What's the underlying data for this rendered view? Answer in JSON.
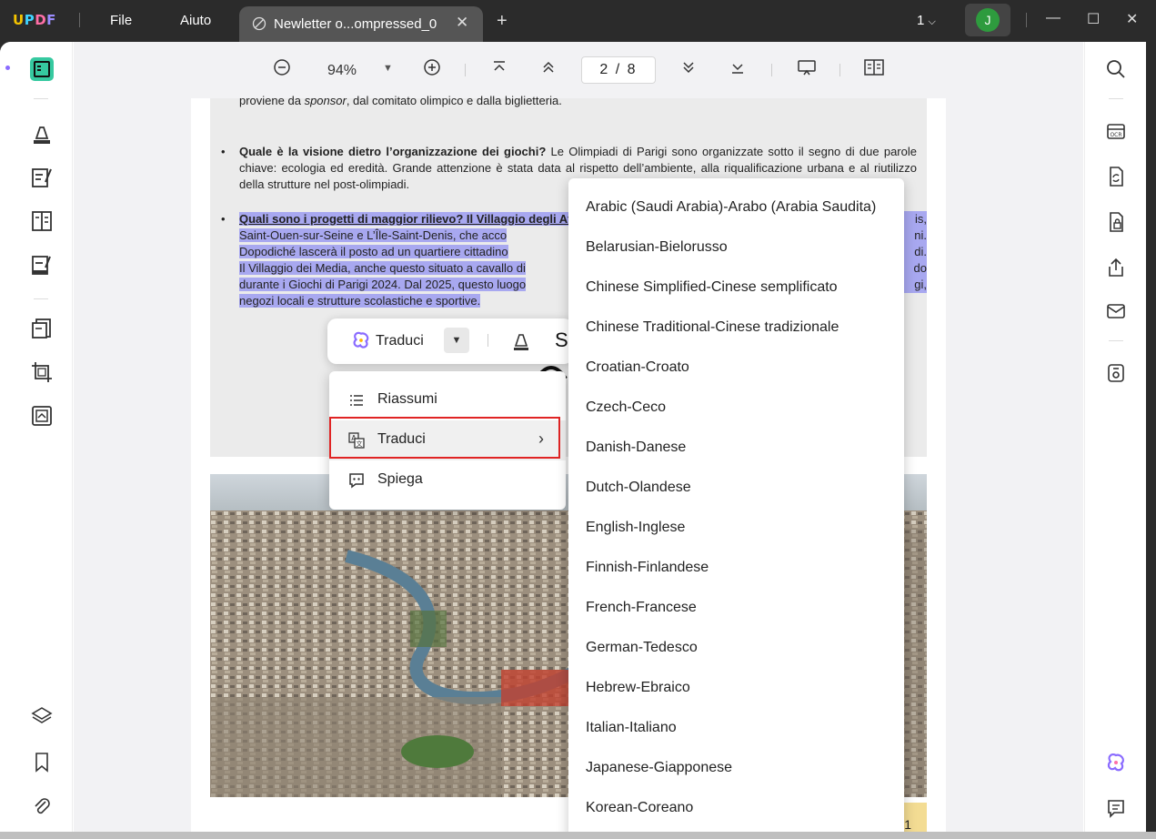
{
  "titlebar": {
    "logo": "UPDF",
    "menu": [
      "File",
      "Aiuto"
    ],
    "tab_title": "Newletter o...ompressed_0",
    "page_indicator": "1",
    "user_initial": "J"
  },
  "toolbar": {
    "zoom": "94%",
    "current_page": "2",
    "total_pages": "8",
    "page_separator": "/"
  },
  "document": {
    "line_top": {
      "prefix": "proviene da ",
      "italic": "sponsor",
      "suffix": ", dal comitato olimpico e dalla biglietteria."
    },
    "bullet2_bold": "Quale è la visione dietro l’organizzazione dei giochi?",
    "bullet2_text": " Le Olimpiadi di Parigi sono organizzate sotto il segno di due parole chiave: ecologia ed eredità. Grande attenzione è stata data al rispetto dell’ambiente, alla riqualificazione urbana e al riutilizzo della strutture nel post-olimpiadi.",
    "bullet3_lines": [
      "Quali sono i progetti di maggior rilievo? Il Villaggio degli At",
      "Saint-Ouen-sur-Seine e L’Île-Saint-Denis, che acco",
      "Dopodiché lascerà il posto ad un quartiere cittadino",
      "Il Villaggio dei Media, anche questo situato a cavallo di",
      "durante i Giochi di Parigi 2024. Dal 2025, questo luogo",
      "negozi locali e strutture scolastiche e sportive."
    ],
    "bullet3_right": [
      "is,",
      "ni.",
      "di.",
      "do",
      "gi,"
    ],
    "page_number": "1"
  },
  "ai_bar": {
    "label": "Traduci"
  },
  "context_menu": {
    "items": [
      {
        "label": "Riassumi",
        "icon": "list-icon"
      },
      {
        "label": "Traduci",
        "icon": "translate-icon"
      },
      {
        "label": "Spiega",
        "icon": "explain-icon"
      }
    ]
  },
  "languages": [
    "Arabic (Saudi Arabia)-Arabo (Arabia Saudita)",
    "Belarusian-Bielorusso",
    "Chinese Simplified-Cinese semplificato",
    "Chinese Traditional-Cinese tradizionale",
    "Croatian-Croato",
    "Czech-Ceco",
    "Danish-Danese",
    "Dutch-Olandese",
    "English-Inglese",
    "Finnish-Finlandese",
    "French-Francese",
    "German-Tedesco",
    "Hebrew-Ebraico",
    "Italian-Italiano",
    "Japanese-Giapponese",
    "Korean-Coreano"
  ],
  "colors": {
    "accent": "#e02424",
    "highlight": "#a8a8f0",
    "avatar": "#2e9b3e"
  }
}
